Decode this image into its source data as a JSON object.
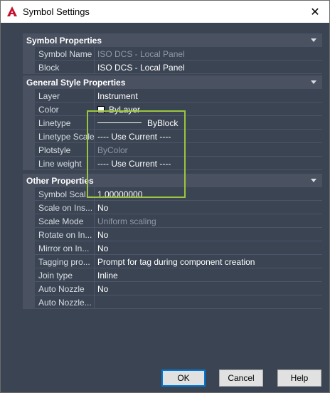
{
  "window": {
    "title": "Symbol Settings"
  },
  "colors": {
    "panel_bg": "#3b4453",
    "category_bg": "#4a5261",
    "highlight": "#9bc53d",
    "accent": "#0078d7",
    "app_icon": "#c8102e"
  },
  "icons": {
    "app": "autocad-a-icon",
    "close": "close-icon",
    "category_toggle": "chevron-down-icon"
  },
  "sections": {
    "symbol": {
      "title": "Symbol Properties",
      "rows": [
        {
          "name": "Symbol Name",
          "value": "ISO DCS - Local Panel"
        },
        {
          "name": "Block",
          "value": "ISO DCS - Local Panel"
        }
      ]
    },
    "general": {
      "title": "General Style Properties",
      "rows": [
        {
          "name": "Layer",
          "value": "Instrument"
        },
        {
          "name": "Color",
          "value": "ByLayer"
        },
        {
          "name": "Linetype",
          "value": "ByBlock"
        },
        {
          "name": "Linetype Scale",
          "value": "---- Use Current ----"
        },
        {
          "name": "Plotstyle",
          "value": "ByColor"
        },
        {
          "name": "Line weight",
          "value": "---- Use Current ----"
        }
      ]
    },
    "other": {
      "title": "Other Properties",
      "rows": [
        {
          "name": "Symbol Scal...",
          "value": "1.00000000"
        },
        {
          "name": "Scale on Ins...",
          "value": "No"
        },
        {
          "name": "Scale Mode",
          "value": "Uniform scaling"
        },
        {
          "name": "Rotate on In...",
          "value": "No"
        },
        {
          "name": "Mirror on In...",
          "value": "No"
        },
        {
          "name": "Tagging pro...",
          "value": "Prompt for tag during component creation"
        },
        {
          "name": "Join type",
          "value": "Inline"
        },
        {
          "name": "Auto Nozzle",
          "value": "No"
        },
        {
          "name": "Auto Nozzle...",
          "value": ""
        }
      ]
    }
  },
  "buttons": {
    "ok": "OK",
    "cancel": "Cancel",
    "help": "Help"
  }
}
